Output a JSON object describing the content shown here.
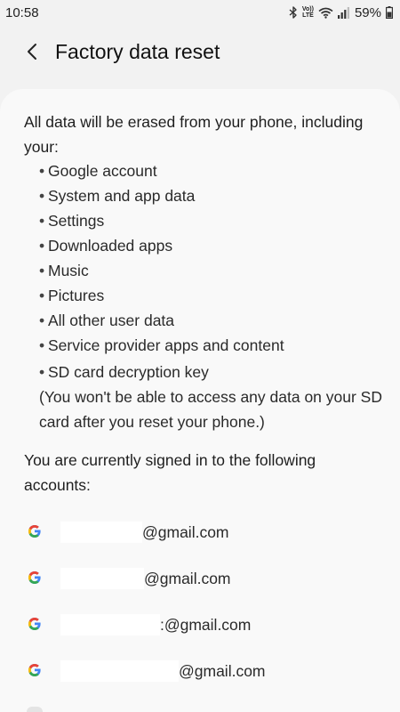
{
  "status_bar": {
    "time": "10:58",
    "volte_top": "Vo))",
    "volte_bottom": "LTE",
    "battery_percent": "59%"
  },
  "header": {
    "title": "Factory data reset"
  },
  "content": {
    "intro": "All data will be erased from your phone, including your:",
    "items": [
      "Google account",
      "System and app data",
      "Settings",
      "Downloaded apps",
      "Music",
      "Pictures",
      "All other user data",
      "Service provider apps and content",
      "SD card decryption key"
    ],
    "sd_note": "(You won't be able to access any data on your SD card after you reset your phone.)",
    "accounts_heading": "You are currently signed in to the following accounts:",
    "accounts": [
      {
        "email_suffix": "@gmail.com"
      },
      {
        "email_suffix": "@gmail.com"
      },
      {
        "email_suffix": ":@gmail.com"
      },
      {
        "email_suffix": "@gmail.com"
      }
    ]
  },
  "icons": {
    "back": "chevron-left-icon",
    "account": "google-g-icon",
    "status": [
      "bluetooth-icon",
      "volte-icon",
      "wifi-icon",
      "signal-icon",
      "battery-icon"
    ]
  },
  "colors": {
    "background": "#f2f2f2",
    "card": "#f9f9f9",
    "text": "#1e1e1e",
    "google_blue": "#4285F4",
    "google_red": "#EA4335",
    "google_yellow": "#FBBC05",
    "google_green": "#34A853"
  }
}
